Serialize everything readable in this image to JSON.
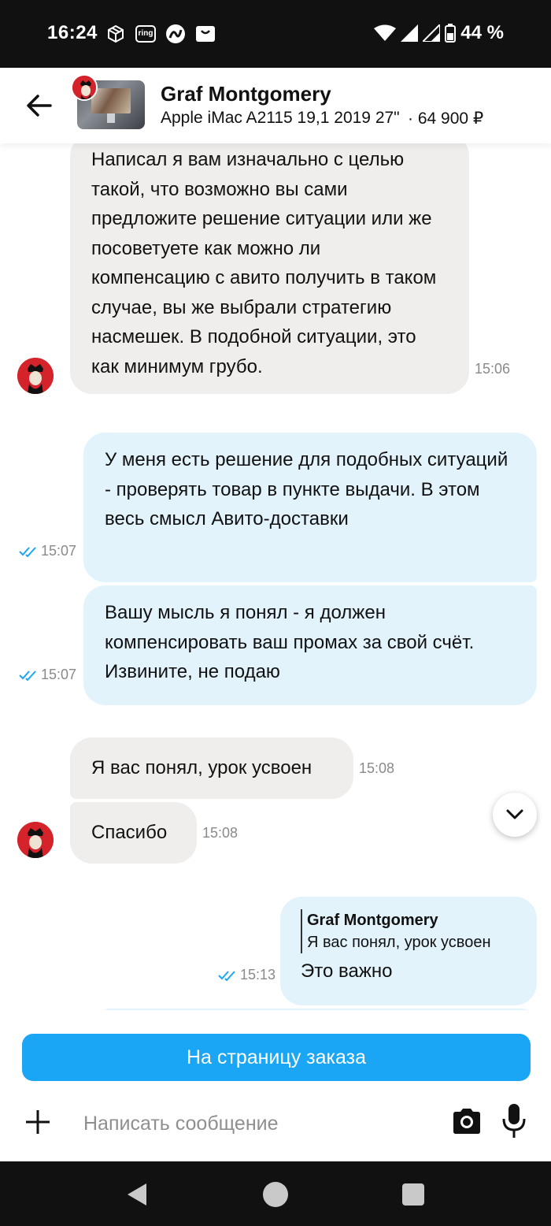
{
  "status_bar": {
    "time": "16:24",
    "battery": "44 %",
    "notification_icons": [
      "package-icon",
      "ring-icon",
      "avito-icon",
      "shop-icon"
    ],
    "ring_label": "ring"
  },
  "header": {
    "name": "Graf Montgomery",
    "item_title": "Apple iMac A2115 19,1 2019 27\" i…",
    "price": "· 64 900 ₽"
  },
  "messages": [
    {
      "id": "m1",
      "direction": "incoming",
      "text": "Написал я вам изначально с целью такой, что возможно вы сами предложите решение ситуации или же посоветуете как можно ли компенсацию с авито получить в таком случае, вы же выбрали стратегию насмешек. В подобной ситуации, это как минимум грубо.",
      "time": "15:06"
    },
    {
      "id": "m2",
      "direction": "outgoing",
      "text": "У меня есть решение для подобных ситуаций - проверять товар в пункте выдачи. В этом весь смысл Авито-доставки",
      "time": "15:07",
      "read": true
    },
    {
      "id": "m3",
      "direction": "outgoing",
      "text": "Вашу мысль я понял - я должен компенсировать ваш промах за свой счёт. Извините,  не подаю",
      "time": "15:07",
      "read": true
    },
    {
      "id": "m4",
      "direction": "incoming",
      "text": "Я вас понял, урок усвоен",
      "time": "15:08"
    },
    {
      "id": "m5",
      "direction": "incoming",
      "text": "Спасибо",
      "time": "15:08"
    },
    {
      "id": "m6",
      "direction": "outgoing",
      "quote_name": "Graf Montgomery",
      "quote_text": "Я вас понял, урок усвоен",
      "text": "Это важно",
      "time": "15:13",
      "read": true
    }
  ],
  "footer": {
    "order_button": "На страницу заказа",
    "input_placeholder": "Написать сообщение"
  },
  "colors": {
    "accent": "#1aa6f5",
    "incoming_bubble": "#f0eeec",
    "outgoing_bubble": "#e2f3fc",
    "read_ticks": "#1aa6f5",
    "avatar_red": "#d4232a"
  }
}
